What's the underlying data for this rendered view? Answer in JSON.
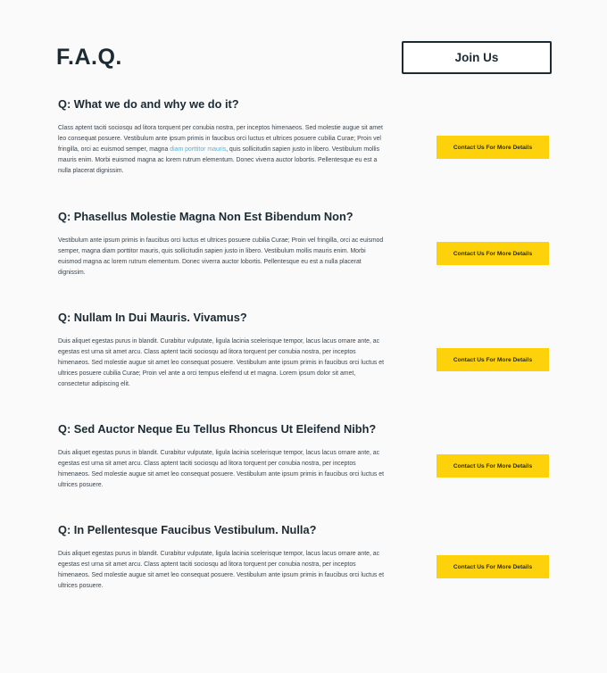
{
  "header": {
    "title": "F.A.Q.",
    "join_label": "Join Us"
  },
  "cta_label": "Contact Us For More Details",
  "faqs": [
    {
      "question": "Q: What we do and why we do it?",
      "answer_before_link": "Class aptent taciti sociosqu ad litora torquent per conubia nostra, per inceptos himenaeos. Sed molestie augue sit amet leo consequat posuere. Vestibulum ante ipsum primis in faucibus orci luctus et ultrices posuere cubilia Curae; Proin vel fringilla, orci ac euismod semper, magna ",
      "answer_link": "diam porttitor mauris",
      "answer_after_link": ", quis sollicitudin sapien justo in libero. Vestibulum mollis mauris enim. Morbi euismod magna ac lorem rutrum elementum. Donec viverra auctor lobortis. Pellentesque eu est a nulla placerat dignissim."
    },
    {
      "question": "Q: Phasellus Molestie Magna Non Est Bibendum Non?",
      "answer": "Vestibulum ante ipsum primis in faucibus orci luctus et ultrices posuere cubilia Curae; Proin vel fringilla, orci ac euismod semper, magna diam porttitor mauris, quis sollicitudin sapien justo in libero. Vestibulum mollis mauris enim. Morbi euismod magna ac lorem rutrum elementum. Donec viverra auctor lobortis. Pellentesque eu est a nulla placerat dignissim."
    },
    {
      "question": "Q: Nullam In Dui Mauris. Vivamus?",
      "answer": "Duis aliquet egestas purus in blandit. Curabitur vulputate, ligula lacinia scelerisque tempor, lacus lacus ornare ante, ac egestas est urna sit amet arcu. Class aptent taciti sociosqu ad litora torquent per conubia nostra, per inceptos himenaeos. Sed molestie augue sit amet leo consequat posuere. Vestibulum ante ipsum primis in faucibus orci luctus et ultrices posuere cubilia Curae; Proin vel ante a orci tempus eleifend ut et magna. Lorem ipsum dolor sit amet, consectetur adipiscing elit."
    },
    {
      "question": "Q: Sed Auctor Neque Eu Tellus Rhoncus Ut Eleifend Nibh?",
      "answer": "Duis aliquet egestas purus in blandit. Curabitur vulputate, ligula lacinia scelerisque tempor, lacus lacus ornare ante, ac egestas est urna sit amet arcu. Class aptent taciti sociosqu ad litora torquent per conubia nostra, per inceptos himenaeos. Sed molestie augue sit amet leo consequat posuere. Vestibulum ante ipsum primis in faucibus orci luctus et ultrices posuere."
    },
    {
      "question": "Q: In Pellentesque Faucibus Vestibulum. Nulla?",
      "answer": "Duis aliquet egestas purus in blandit. Curabitur vulputate, ligula lacinia scelerisque tempor, lacus lacus ornare ante, ac egestas est urna sit amet arcu. Class aptent taciti sociosqu ad litora torquent per conubia nostra, per inceptos himenaeos. Sed molestie augue sit amet leo consequat posuere. Vestibulum ante ipsum primis in faucibus orci luctus et ultrices posuere."
    }
  ],
  "colors": {
    "text": "#1c2a33",
    "accent": "#fdd20a",
    "link": "#5ab0d6",
    "background": "#fafafa"
  }
}
